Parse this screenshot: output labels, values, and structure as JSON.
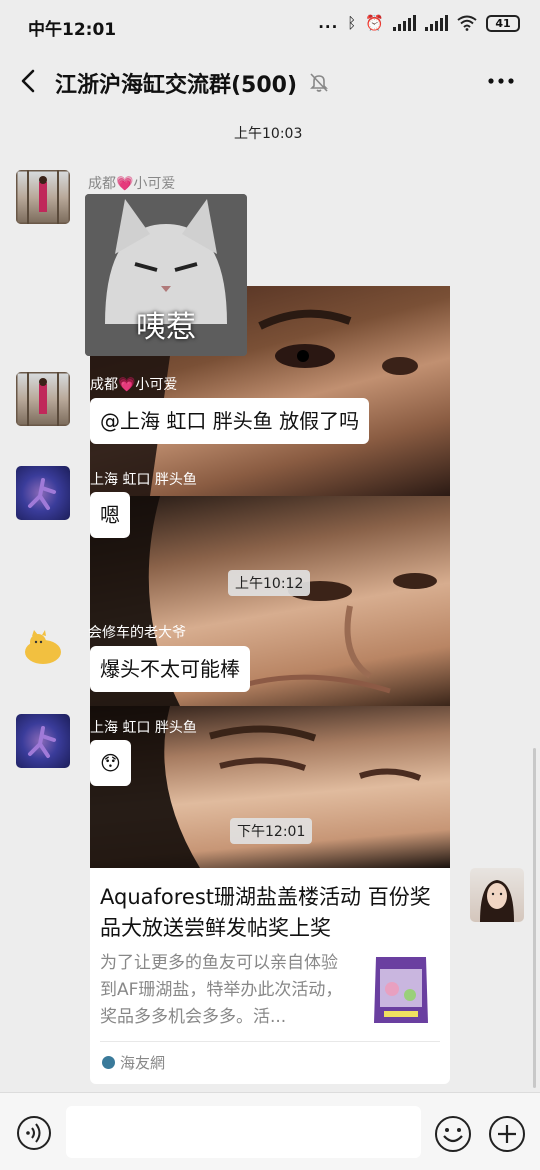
{
  "status_bar": {
    "time": "中午12:01",
    "dots": "...",
    "battery": "41"
  },
  "header": {
    "title": "江浙沪海缸交流群(500)"
  },
  "messages": {
    "ts1": "上午10:03",
    "ts2": "上午10:12",
    "ts3": "下午12:01",
    "m1_sender": "成都💗小可爱",
    "m1_sticker_text": "咦惹",
    "m2_sender": "成都💗小可爱",
    "m2_text": "@上海 虹口 胖头鱼  放假了吗",
    "m3_sender": "上海 虹口 胖头鱼",
    "m3_text": "嗯",
    "m4_sender": "会修车的老大爷",
    "m4_text": "爆头不太可能棒",
    "m5_sender": "上海 虹口 胖头鱼",
    "m5_text": "😯"
  },
  "card": {
    "title": "Aquaforest珊湖盐盖楼活动 百份奖品大放送尝鲜发帖奖上奖",
    "desc": "为了让更多的鱼友可以亲自体验到AF珊湖盐，特举办此次活动，奖品多多机会多多。活...",
    "source": "海友網"
  },
  "colors": {
    "background": "#ededed",
    "bubble": "#ffffff",
    "meta_text": "#888888"
  }
}
